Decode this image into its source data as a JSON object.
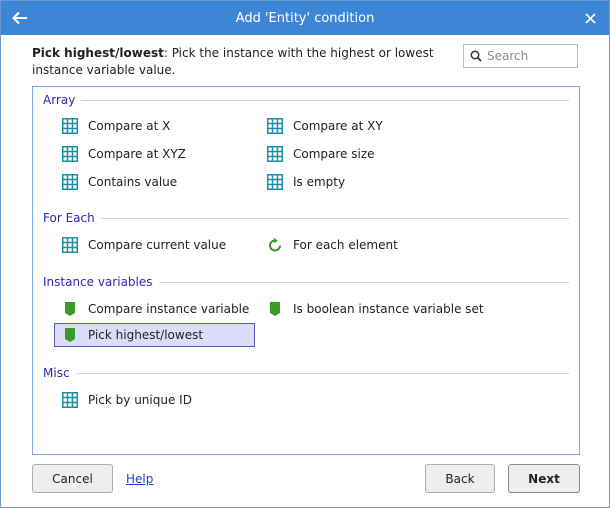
{
  "window": {
    "title": "Add 'Entity' condition",
    "back_icon": "arrow-left-icon",
    "close_icon": "close-icon"
  },
  "description": {
    "bold": "Pick highest/lowest",
    "text": ": Pick the instance with the highest or lowest instance variable value."
  },
  "search": {
    "placeholder": "Search",
    "value": ""
  },
  "groups": [
    {
      "label": "Array",
      "items": [
        {
          "label": "Compare at X",
          "icon": "grid-icon"
        },
        {
          "label": "Compare at XY",
          "icon": "grid-icon"
        },
        {
          "label": "Compare at XYZ",
          "icon": "grid-icon"
        },
        {
          "label": "Compare size",
          "icon": "grid-icon"
        },
        {
          "label": "Contains value",
          "icon": "grid-icon"
        },
        {
          "label": "Is empty",
          "icon": "grid-icon"
        }
      ]
    },
    {
      "label": "For Each",
      "items": [
        {
          "label": "Compare current value",
          "icon": "grid-icon"
        },
        {
          "label": "For each element",
          "icon": "loop-arrow-icon"
        }
      ]
    },
    {
      "label": "Instance variables",
      "items": [
        {
          "label": "Compare instance variable",
          "icon": "tag-icon"
        },
        {
          "label": "Is boolean instance variable set",
          "icon": "tag-icon"
        },
        {
          "label": "Pick highest/lowest",
          "icon": "tag-icon",
          "selected": true
        }
      ]
    },
    {
      "label": "Misc",
      "items": [
        {
          "label": "Pick by unique ID",
          "icon": "grid-icon"
        }
      ]
    }
  ],
  "footer": {
    "cancel_label": "Cancel",
    "help_label": "Help",
    "back_label": "Back",
    "next_label": "Next"
  },
  "colors": {
    "titlebar": "#3d86d6",
    "group_header": "#2b2bb0",
    "grid_icon": "#1f8fa8",
    "tag_icon": "#3a9a2a",
    "selection_bg": "#dcdcfa",
    "selection_border": "#5b5bc8"
  }
}
